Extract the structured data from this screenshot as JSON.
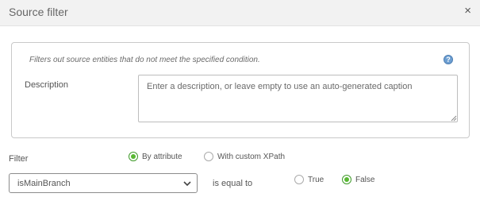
{
  "dialog": {
    "title": "Source filter",
    "close_glyph": "×"
  },
  "panel": {
    "hint": "Filters out source entities that do not meet the specified condition.",
    "help_glyph": "?",
    "description_label": "Description",
    "description_value": "",
    "description_placeholder": "Enter a description, or leave empty to use an auto-generated caption"
  },
  "filter": {
    "label": "Filter",
    "mode_options": [
      {
        "label": "By attribute",
        "selected": true
      },
      {
        "label": "With custom XPath",
        "selected": false
      }
    ],
    "attribute_selected": "isMainBranch",
    "operator_text": "is equal to",
    "value_options": [
      {
        "label": "True",
        "selected": false
      },
      {
        "label": "False",
        "selected": true
      }
    ]
  },
  "colors": {
    "accent_green": "#58b832",
    "help_blue": "#6d9fd2",
    "titlebar_bg": "#f2f2f2"
  },
  "icons": {
    "close": "close-icon",
    "help": "help-icon",
    "dropdown": "chevron-down-icon",
    "resize": "resize-grip-icon"
  }
}
